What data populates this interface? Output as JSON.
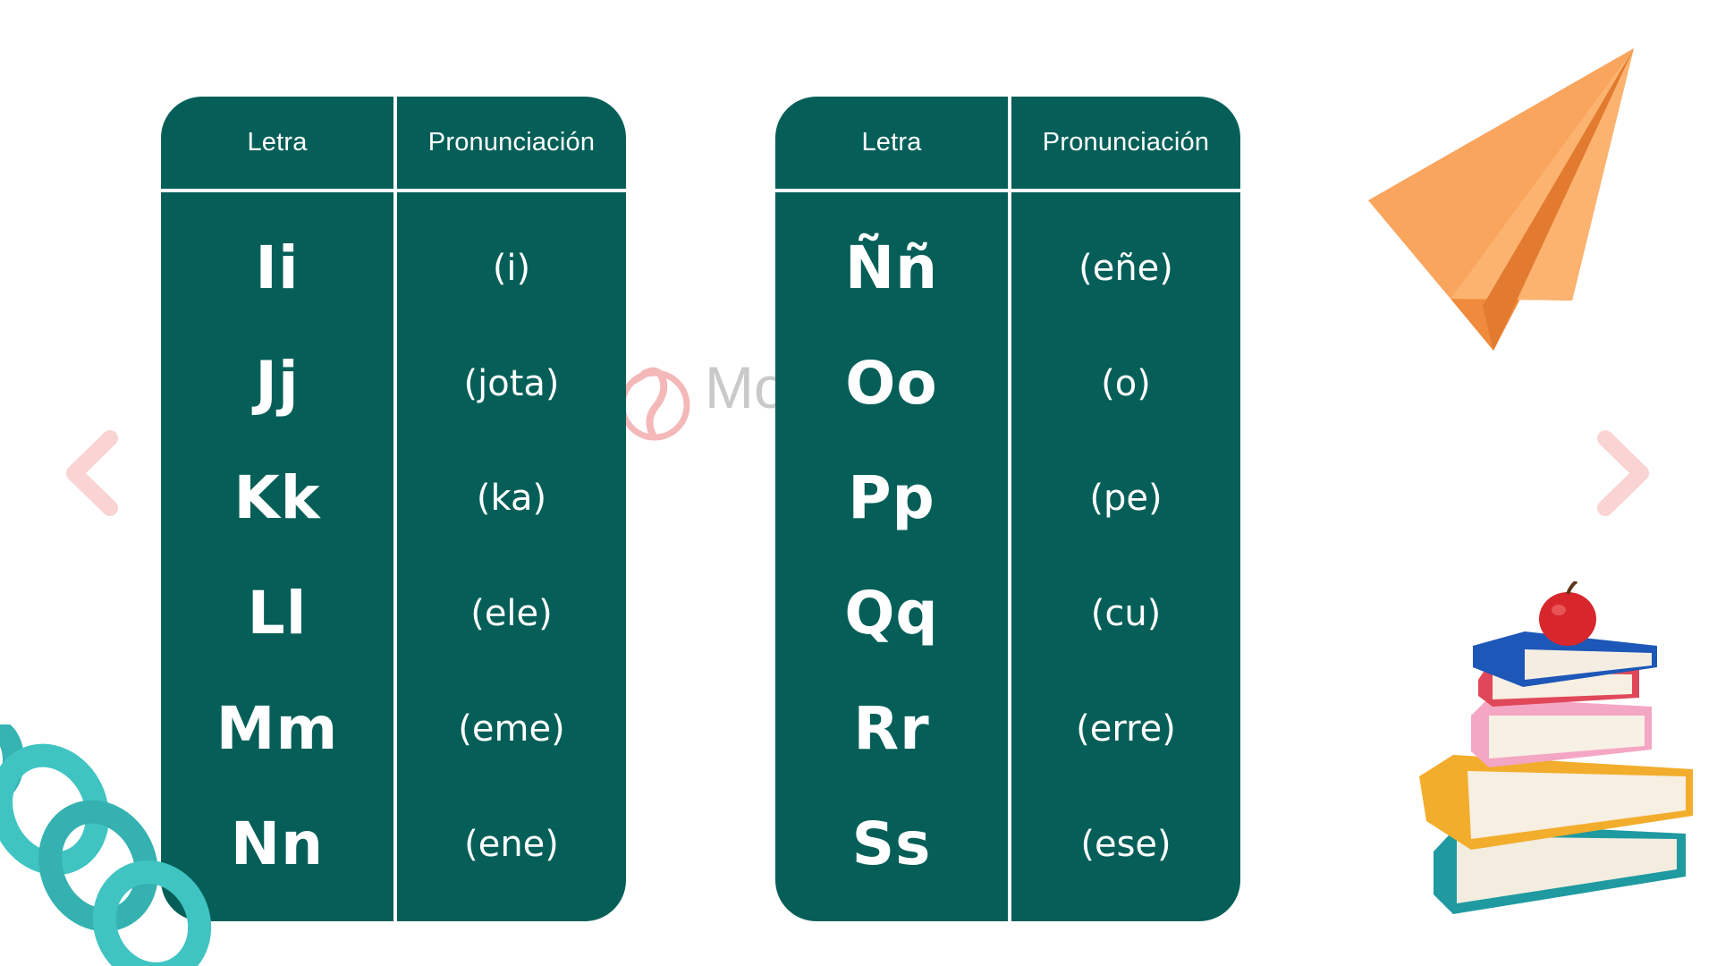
{
  "tables": [
    {
      "header": {
        "letter": "Letra",
        "pronunciation": "Pronunciación"
      },
      "rows": [
        {
          "letter": "Ii",
          "pronunciation": "(i)"
        },
        {
          "letter": "Jj",
          "pronunciation": "(jota)"
        },
        {
          "letter": "Kk",
          "pronunciation": "(ka)"
        },
        {
          "letter": "Ll",
          "pronunciation": "(ele)"
        },
        {
          "letter": "Mm",
          "pronunciation": "(eme)"
        },
        {
          "letter": "Nn",
          "pronunciation": "(ene)"
        }
      ]
    },
    {
      "header": {
        "letter": "Letra",
        "pronunciation": "Pronunciación"
      },
      "rows": [
        {
          "letter": "Ññ",
          "pronunciation": "(eñe)"
        },
        {
          "letter": "Oo",
          "pronunciation": "(o)"
        },
        {
          "letter": "Pp",
          "pronunciation": "(pe)"
        },
        {
          "letter": "Qq",
          "pronunciation": "(cu)"
        },
        {
          "letter": "Rr",
          "pronunciation": "(erre)"
        },
        {
          "letter": "Ss",
          "pronunciation": "(ese)"
        }
      ]
    }
  ],
  "watermark": {
    "text": "Mo"
  },
  "navigation": {
    "prev_icon": "chevron-left-icon",
    "next_icon": "chevron-right-icon"
  },
  "colors": {
    "table_bg": "#055f58",
    "text": "#ffffff",
    "arrow": "#fad3d3",
    "plane": "#f7a55c",
    "watermark": "#c9c9c9"
  }
}
